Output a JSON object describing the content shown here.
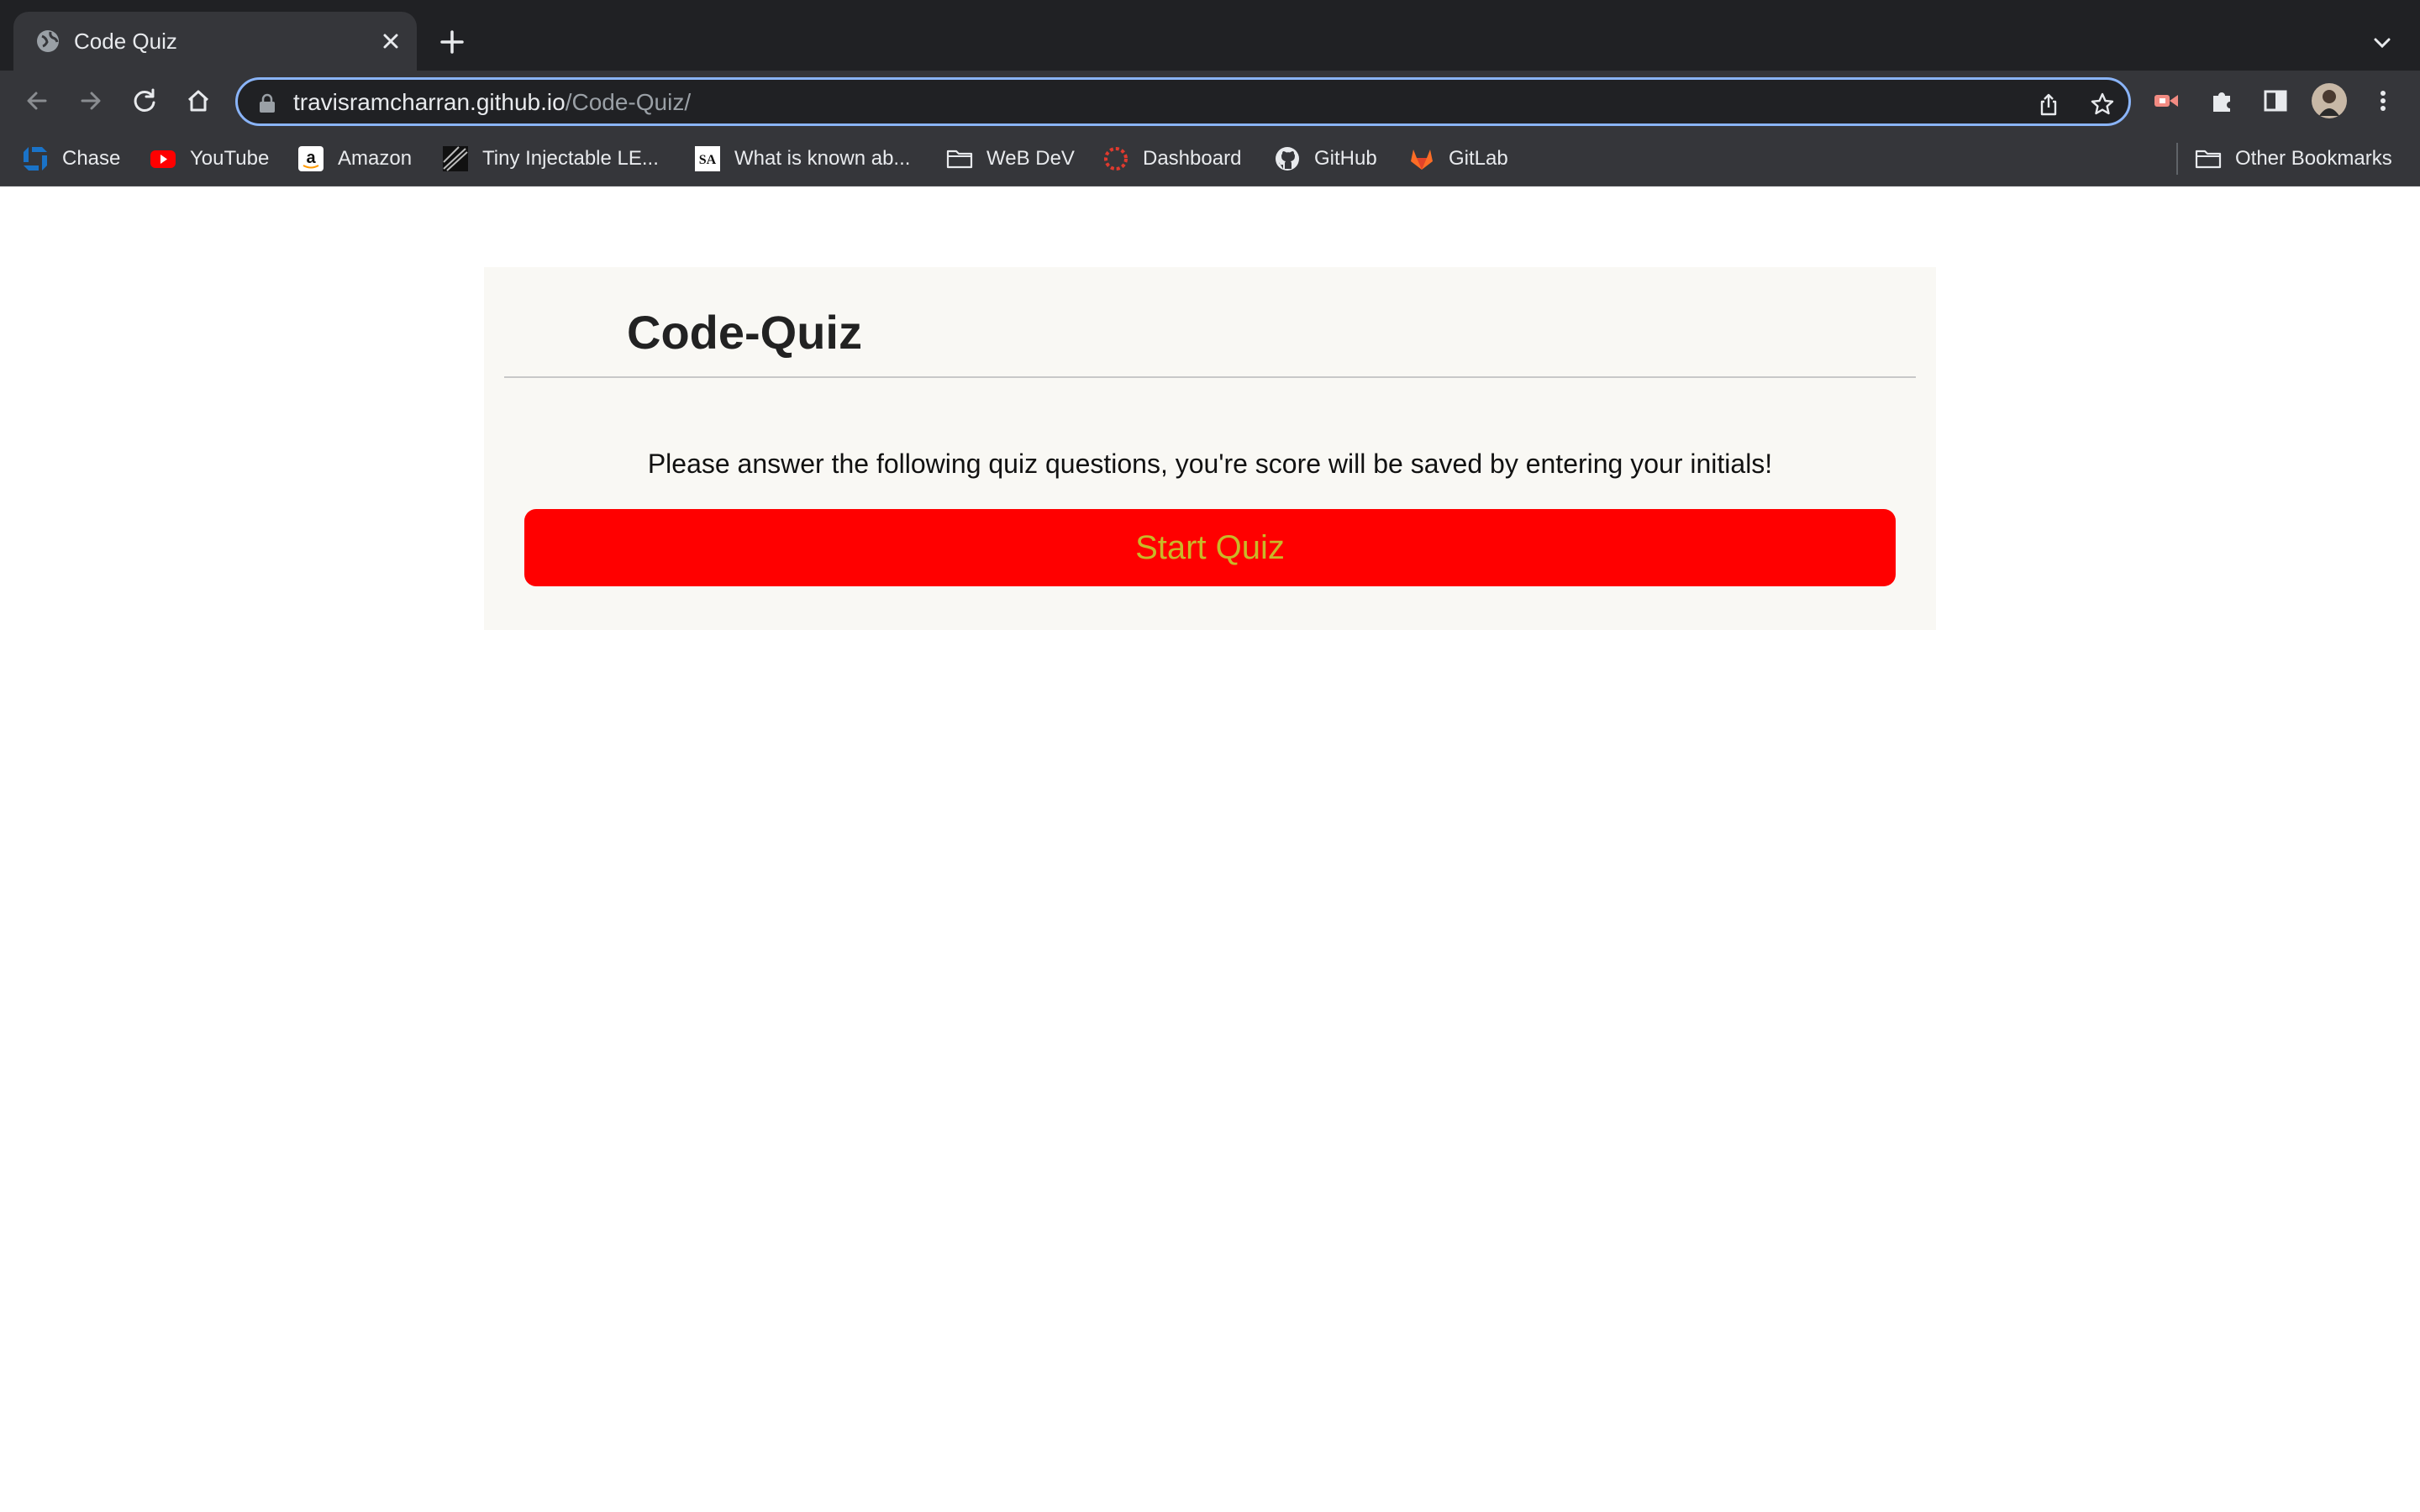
{
  "browser": {
    "tab": {
      "title": "Code Quiz",
      "favicon": "globe-icon"
    },
    "url": {
      "host": "travisramcharran.github.io",
      "path": "/Code-Quiz/"
    },
    "bookmarks": [
      {
        "label": "Chase",
        "icon": "chase-icon"
      },
      {
        "label": "YouTube",
        "icon": "youtube-icon"
      },
      {
        "label": "Amazon",
        "icon": "amazon-icon"
      },
      {
        "label": "Tiny Injectable LE...",
        "icon": "page-icon"
      },
      {
        "label": "What is known ab...",
        "icon": "sa-icon"
      },
      {
        "label": "WeB DeV",
        "icon": "folder-icon"
      },
      {
        "label": "Dashboard",
        "icon": "dashboard-icon"
      },
      {
        "label": "GitHub",
        "icon": "github-icon"
      },
      {
        "label": "GitLab",
        "icon": "gitlab-icon"
      }
    ],
    "other_bookmarks": "Other Bookmarks"
  },
  "quiz": {
    "title": "Code-Quiz",
    "instructions": "Please answer the following quiz questions, you're score will be saved by entering your initials!",
    "start_label": "Start Quiz",
    "colors": {
      "button": "#ff0000",
      "button_text": "#c8b828",
      "card": "#f9f8f4"
    }
  }
}
